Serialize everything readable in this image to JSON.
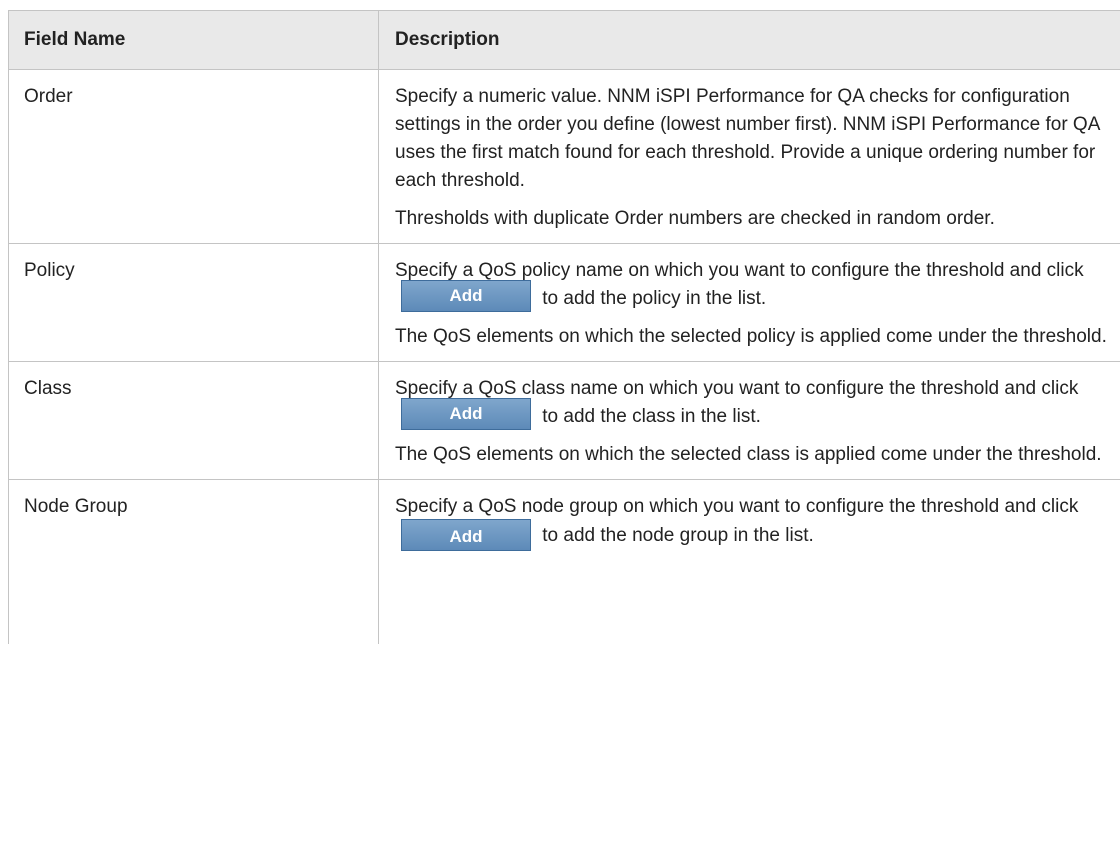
{
  "table": {
    "headers": {
      "field": "Field Name",
      "description": "Description"
    },
    "rows": [
      {
        "field": "Order",
        "paragraphs": [
          "Specify a numeric value. NNM iSPI Performance for QA checks for configuration settings in the order you define (lowest number first). NNM iSPI Performance for QA uses the first match found for each threshold. Provide a unique ordering number for each threshold.",
          "Thresholds with duplicate Order numbers are checked in random order."
        ]
      },
      {
        "field": "Policy",
        "p1_before": "Specify a QoS policy name on which you want to configure the threshold and click",
        "button": "Add",
        "p1_after": "to add the policy in the list.",
        "p2": "The QoS elements on which the selected policy is applied come under the threshold."
      },
      {
        "field": "Class",
        "p1_before": "Specify a QoS class name on which you want to configure the threshold and click",
        "button": "Add",
        "p1_after": "to add the class in the list.",
        "p2": "The QoS elements on which the selected class is applied come under the threshold."
      },
      {
        "field": "Node Group",
        "p1_before": "Specify a QoS node group on which you want to configure the threshold and click",
        "button": "Add",
        "p1_after": "to add the node group in the list."
      }
    ]
  }
}
